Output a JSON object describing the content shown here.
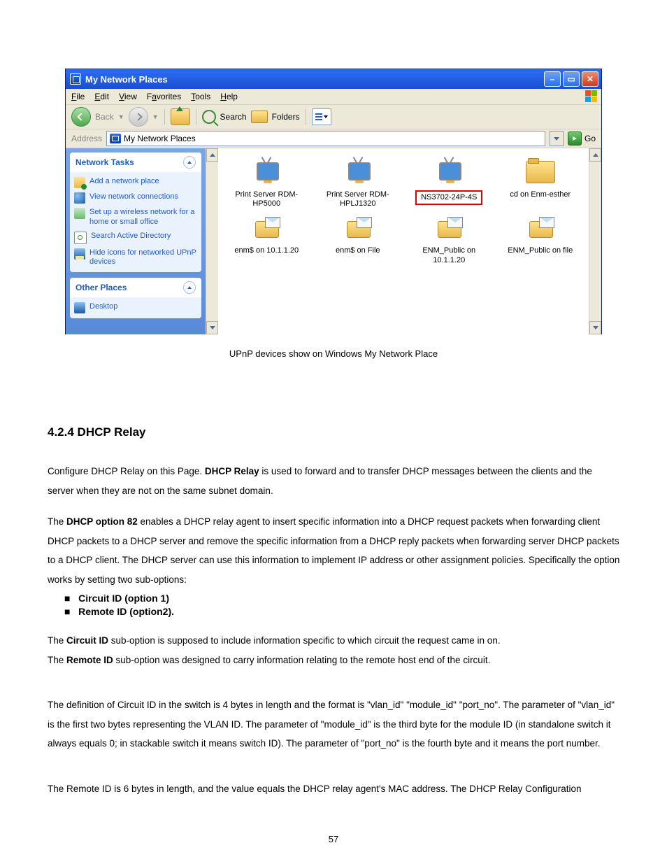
{
  "window": {
    "title": "My Network Places",
    "menu": {
      "file": "File",
      "edit": "Edit",
      "view": "View",
      "favorites": "Favorites",
      "tools": "Tools",
      "help": "Help"
    },
    "toolbar": {
      "back": "Back",
      "search": "Search",
      "folders": "Folders"
    },
    "address": {
      "label": "Address",
      "value": "My Network Places",
      "go": "Go"
    },
    "tasks": {
      "header": "Network Tasks",
      "items": [
        "Add a network place",
        "View network connections",
        "Set up a wireless network for a home or small office",
        "Search Active Directory",
        "Hide icons for networked UPnP devices"
      ]
    },
    "other": {
      "header": "Other Places",
      "items": [
        "Desktop"
      ]
    },
    "grid": [
      {
        "label": "Print Server RDM-HP5000",
        "type": "ps"
      },
      {
        "label": "Print Server RDM-HPLJ1320",
        "type": "ps"
      },
      {
        "label": "NS3702-24P-4S",
        "type": "ps",
        "selected": true
      },
      {
        "label": "cd on Enm-esther",
        "type": "folder"
      },
      {
        "label": "enm$ on 10.1.1.20",
        "type": "share"
      },
      {
        "label": "enm$ on File",
        "type": "share"
      },
      {
        "label": "ENM_Public on 10.1.1.20",
        "type": "share"
      },
      {
        "label": "ENM_Public on file",
        "type": "share"
      }
    ]
  },
  "caption": "UPnP devices show on Windows My Network Place",
  "section_num": "4.2.4",
  "section_title": "DHCP Relay",
  "p1a": "Configure DHCP Relay on this Page. ",
  "p1b": "DHCP Relay",
  "p1c": " is used to forward and to transfer DHCP messages between the clients and the server when they are not on the same subnet domain.",
  "p2a": "The ",
  "p2b": "DHCP option 82",
  "p2c": " enables a DHCP relay agent to insert specific information into a DHCP request packets when forwarding client DHCP packets to a DHCP server and remove the specific information from a DHCP reply packets when forwarding server DHCP packets to a DHCP client. The DHCP server can use this information to implement IP address or other assignment policies. Specifically the option works by setting two sub-options:",
  "b1": "Circuit ID (option 1)",
  "b2": "Remote ID (option2).",
  "p3a": "The ",
  "p3b": "Circuit ID",
  "p3c": " sub-option is supposed to include information specific to which circuit the request came in on.",
  "p3d": "The ",
  "p3e": "Remote ID",
  "p3f": " sub-option was designed to carry information relating to the remote host end of the circuit.",
  "p4": "The definition of Circuit ID in the switch is 4 bytes in length and the format is \"vlan_id\" \"module_id\" \"port_no\". The parameter of \"vlan_id\" is the first two bytes representing the VLAN ID. The parameter of \"module_id\" is the third byte for the module ID (in standalone switch it always equals 0; in stackable switch it means switch ID). The parameter of \"port_no\" is the fourth byte and it means the port number.",
  "p5": "The Remote ID is 6 bytes in length, and the value equals the DHCP relay agent's MAC address. The DHCP Relay Configuration",
  "pagenum": "57"
}
